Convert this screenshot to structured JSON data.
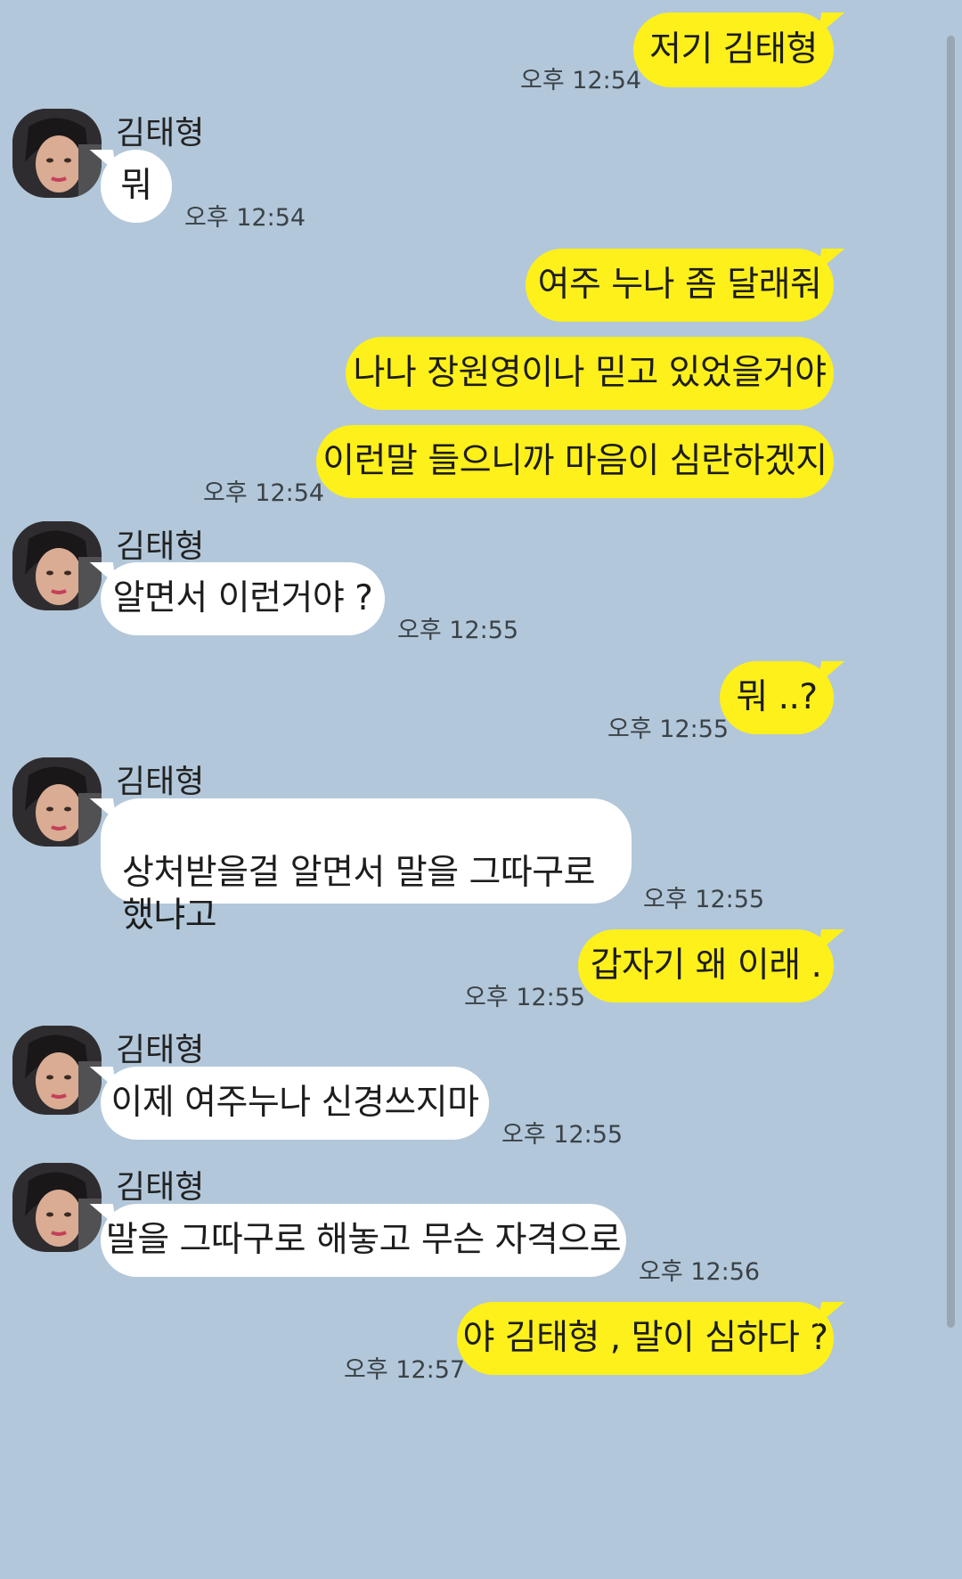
{
  "contact": {
    "name": "김태형"
  },
  "colors": {
    "background": "#b2c7da",
    "my_bubble": "#fef01b",
    "their_bubble": "#ffffff"
  },
  "messages": [
    {
      "sender": "me",
      "text": "저기 김태형",
      "time": "오후 12:54"
    },
    {
      "sender": "김태형",
      "text": "뭐",
      "time": "오후 12:54"
    },
    {
      "sender": "me",
      "text": "여주 누나 좀 달래줘",
      "time": ""
    },
    {
      "sender": "me",
      "text": "나나 장원영이나 믿고 있었을거야",
      "time": ""
    },
    {
      "sender": "me",
      "text": "이런말 들으니까 마음이 심란하겠지",
      "time": "오후 12:54"
    },
    {
      "sender": "김태형",
      "text": "알면서 이런거야 ?",
      "time": "오후 12:55"
    },
    {
      "sender": "me",
      "text": "뭐 ..?",
      "time": "오후 12:55"
    },
    {
      "sender": "김태형",
      "text": "상처받을걸 알면서 말을 그따구로\n했냐고",
      "time": "오후 12:55"
    },
    {
      "sender": "me",
      "text": "갑자기 왜 이래 .",
      "time": "오후 12:55"
    },
    {
      "sender": "김태형",
      "text": "이제 여주누나 신경쓰지마",
      "time": "오후 12:55"
    },
    {
      "sender": "김태형",
      "text": "말을 그따구로 해놓고 무슨 자격으로",
      "time": "오후 12:56"
    },
    {
      "sender": "me",
      "text": "야 김태형 , 말이 심하다 ?",
      "time": "오후 12:57"
    }
  ]
}
